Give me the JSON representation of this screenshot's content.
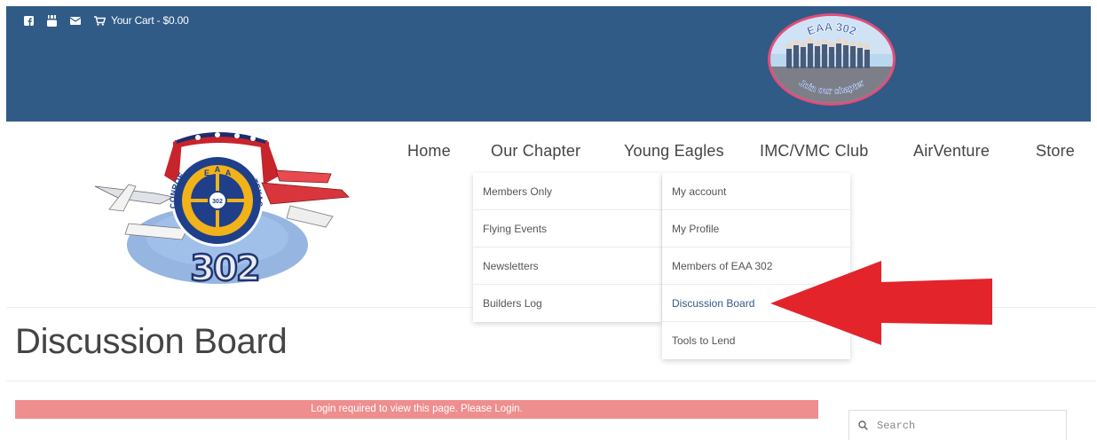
{
  "topbar": {
    "icons": [
      "facebook-icon",
      "youtube-icon",
      "envelope-icon"
    ],
    "cart_icon": "cart-icon",
    "cart_label": "Your Cart - $0.00",
    "bg_color": "#2f5b86"
  },
  "nav": {
    "items": [
      {
        "label": "Home"
      },
      {
        "label": "Our Chapter"
      },
      {
        "label": "Young Eagles"
      },
      {
        "label": "IMC/VMC Club"
      },
      {
        "label": "AirVenture"
      },
      {
        "label": "Store"
      }
    ]
  },
  "chapter_menu": {
    "items": [
      {
        "label": "Members Only"
      },
      {
        "label": "Flying Events"
      },
      {
        "label": "Newsletters"
      },
      {
        "label": "Builders Log"
      }
    ]
  },
  "account_menu": {
    "items": [
      {
        "label": "My account"
      },
      {
        "label": "My Profile"
      },
      {
        "label": "Members of EAA 302"
      },
      {
        "label": "Discussion Board"
      },
      {
        "label": "Tools to Lend"
      }
    ]
  },
  "logo": {
    "badge_letters": [
      "E",
      "A",
      "A"
    ],
    "ring_left": "CONROE",
    "ring_right": "TEXAS",
    "number": "302",
    "center": "302"
  },
  "badge": {
    "top": "EAA 302",
    "bottom": "Join our chapter"
  },
  "page": {
    "title": "Discussion Board",
    "alert": "Login required to view this page. Please Login.",
    "alert_color": "#ef8e8e"
  },
  "search": {
    "placeholder": "Search"
  },
  "annotation": {
    "arrow_color": "#e3242b"
  }
}
